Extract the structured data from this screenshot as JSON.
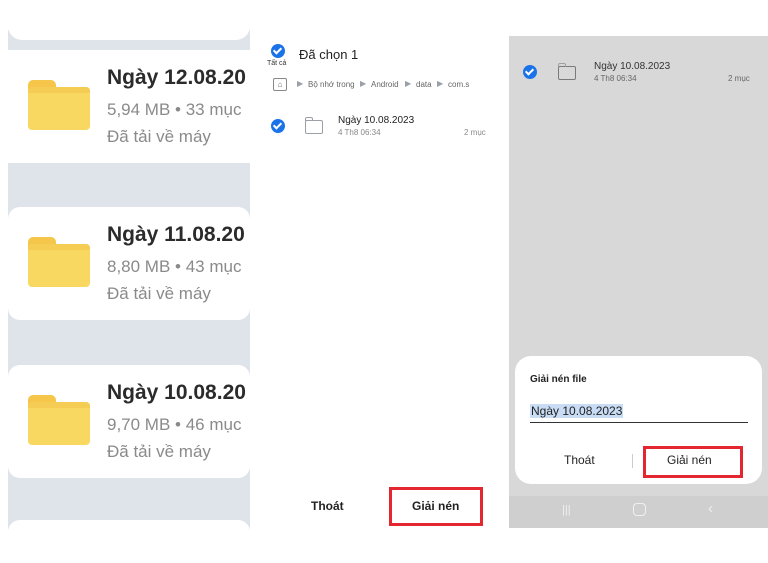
{
  "panel1": {
    "cards": [
      {
        "title": "Ngày 12.08.20",
        "meta": "5,94 MB • 33 mục",
        "status": "Đã tải về máy"
      },
      {
        "title": "Ngày 11.08.20",
        "meta": "8,80 MB • 43 mục",
        "status": "Đã tải về máy"
      },
      {
        "title": "Ngày 10.08.20",
        "meta": "9,70 MB • 46 mục",
        "status": "Đã tải về máy"
      }
    ]
  },
  "panel2": {
    "select_all_label": "Tất cả",
    "header_title": "Đã chọn 1",
    "breadcrumb": [
      "Bộ nhớ trong",
      "Android",
      "data",
      "com.s"
    ],
    "item": {
      "name": "Ngày 10.08.2023",
      "date": "4 Th8 06:34",
      "count": "2 mục"
    },
    "cancel_label": "Thoát",
    "extract_label": "Giải nén"
  },
  "panel3": {
    "item": {
      "name": "Ngày 10.08.2023",
      "date": "4 Th8 06:34",
      "count": "2 mục"
    },
    "dialog": {
      "title": "Giải nén file",
      "input_value": "Ngày 10.08.2023",
      "cancel_label": "Thoát",
      "extract_label": "Giải nén"
    },
    "nav": {
      "recents": "|||",
      "home": "○",
      "back": "‹"
    }
  },
  "colors": {
    "accent": "#1a73e8",
    "highlight": "#e3262f",
    "folder": "#f9d862"
  }
}
